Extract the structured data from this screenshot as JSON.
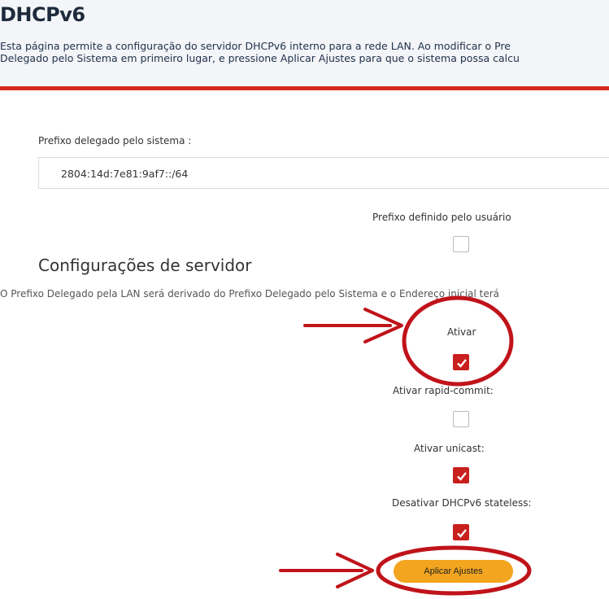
{
  "header": {
    "title": "DHCPv6",
    "description_line1": "Esta página permite a configuração do servidor DHCPv6 interno para a rede LAN. Ao modificar o Pre",
    "description_line2": "Delegado pelo Sistema em primeiro lugar, e pressione Aplicar Ajustes para que o sistema possa calcu"
  },
  "prefix": {
    "label": "Prefixo delegado pelo sistema :",
    "value": "2804:14d:7e81:9af7::/64",
    "user_defined_label": "Prefixo definido pelo usuário",
    "user_defined_checked": false
  },
  "server": {
    "section_title": "Configurações de servidor",
    "info": "O Prefixo Delegado pela LAN será derivado do Prefixo Delegado pelo Sistema e o Endereço inicial terá",
    "options": [
      {
        "label": "Ativar",
        "checked": true
      },
      {
        "label": "Ativar rapid-commit:",
        "checked": false
      },
      {
        "label": "Ativar unicast:",
        "checked": true
      },
      {
        "label": "Desativar DHCPv6 stateless:",
        "checked": true
      }
    ],
    "apply_label": "Aplicar Ajustes"
  },
  "annotation_color": "#c0131a",
  "checkbox_color": "#c8201e",
  "button_color": "#f3a51f"
}
